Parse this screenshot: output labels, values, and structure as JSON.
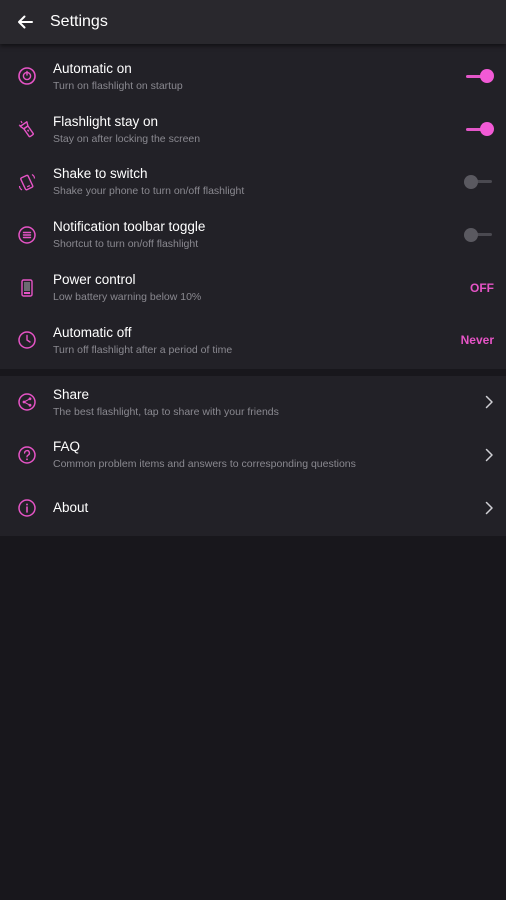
{
  "appbar": {
    "title": "Settings",
    "back_icon": "arrow-left-icon"
  },
  "colors": {
    "accent": "#f25ad6",
    "background": "#18171c",
    "section": "#222127",
    "appbar": "#29282d",
    "subtitle": "#8a8990"
  },
  "settings": [
    {
      "icon": "power-icon",
      "title": "Automatic on",
      "subtitle": "Turn on flashlight on startup",
      "control": "toggle",
      "checked": true
    },
    {
      "icon": "flashlight-icon",
      "title": "Flashlight stay on",
      "subtitle": "Stay on after locking the screen",
      "control": "toggle",
      "checked": true
    },
    {
      "icon": "shake-phone-icon",
      "title": "Shake to switch",
      "subtitle": "Shake your phone to turn on/off flashlight",
      "control": "toggle",
      "checked": false
    },
    {
      "icon": "notification-list-icon",
      "title": "Notification toolbar toggle",
      "subtitle": "Shortcut to turn on/off flashlight",
      "control": "toggle",
      "checked": false
    },
    {
      "icon": "battery-icon",
      "title": "Power control",
      "subtitle": "Low battery warning below 10%",
      "control": "value",
      "value": "OFF"
    },
    {
      "icon": "clock-icon",
      "title": "Automatic off",
      "subtitle": "Turn off flashlight after a period of time",
      "control": "value",
      "value": "Never"
    }
  ],
  "more": [
    {
      "icon": "share-icon",
      "title": "Share",
      "subtitle": "The best flashlight, tap to share with your friends",
      "control": "chevron"
    },
    {
      "icon": "question-icon",
      "title": "FAQ",
      "subtitle": "Common problem items and answers to corresponding questions",
      "control": "chevron"
    },
    {
      "icon": "info-icon",
      "title": "About",
      "subtitle": "",
      "control": "chevron"
    }
  ]
}
